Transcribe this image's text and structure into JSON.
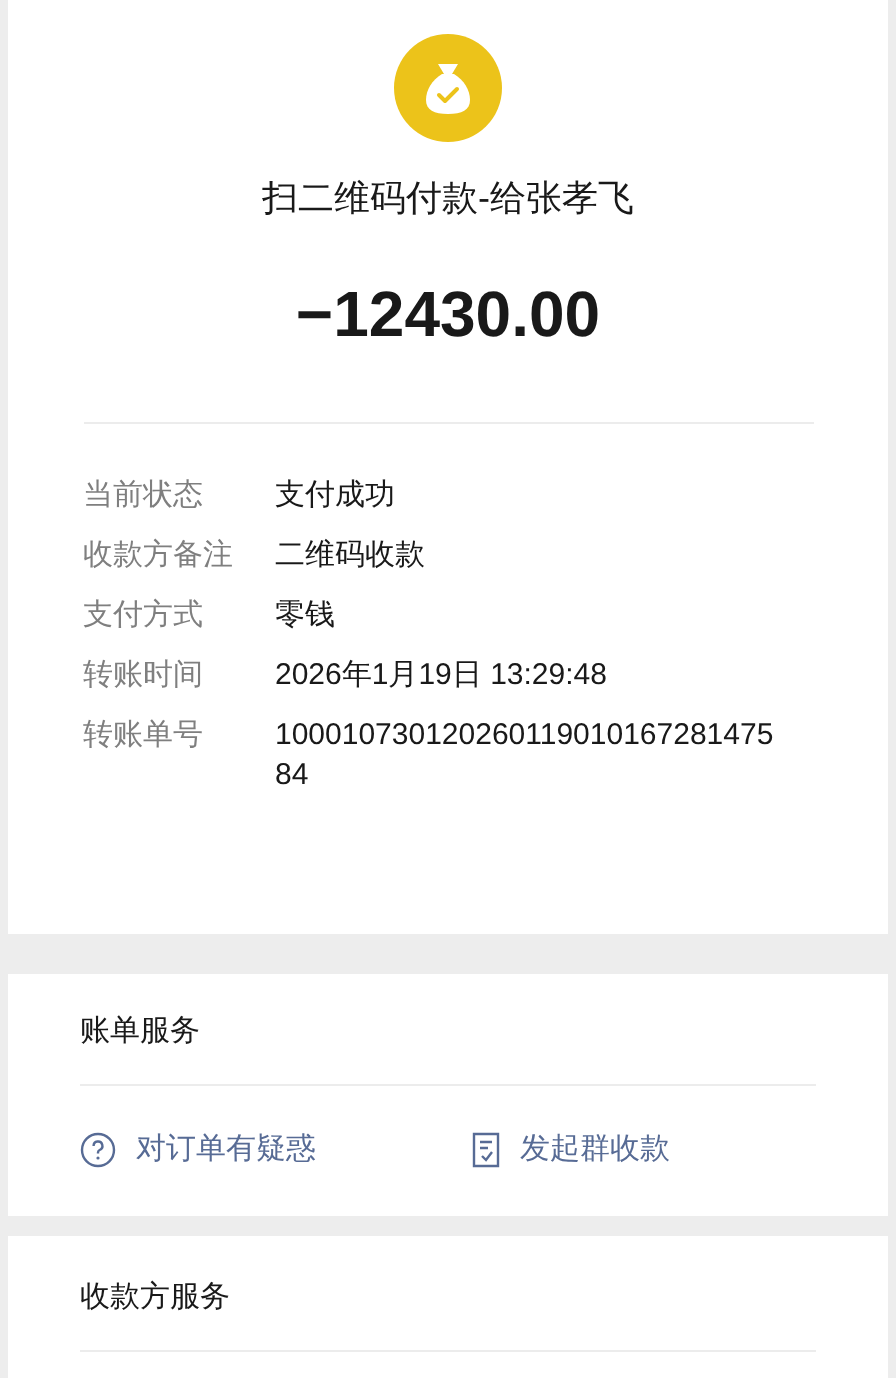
{
  "payment": {
    "title": "扫二维码付款-给张孝飞",
    "amount": "−12430.00"
  },
  "details": [
    {
      "label": "当前状态",
      "value": "支付成功"
    },
    {
      "label": "收款方备注",
      "value": "二维码收款"
    },
    {
      "label": "支付方式",
      "value": "零钱"
    },
    {
      "label": "转账时间",
      "value": "2026年1月19日 13:29:48"
    },
    {
      "label": "转账单号",
      "value": "10001073012026011901016728147584"
    }
  ],
  "bill_service": {
    "title": "账单服务",
    "actions": [
      {
        "kind": "question",
        "label": "对订单有疑惑"
      },
      {
        "kind": "group",
        "label": "发起群收款"
      }
    ]
  },
  "payee_service": {
    "title": "收款方服务"
  }
}
